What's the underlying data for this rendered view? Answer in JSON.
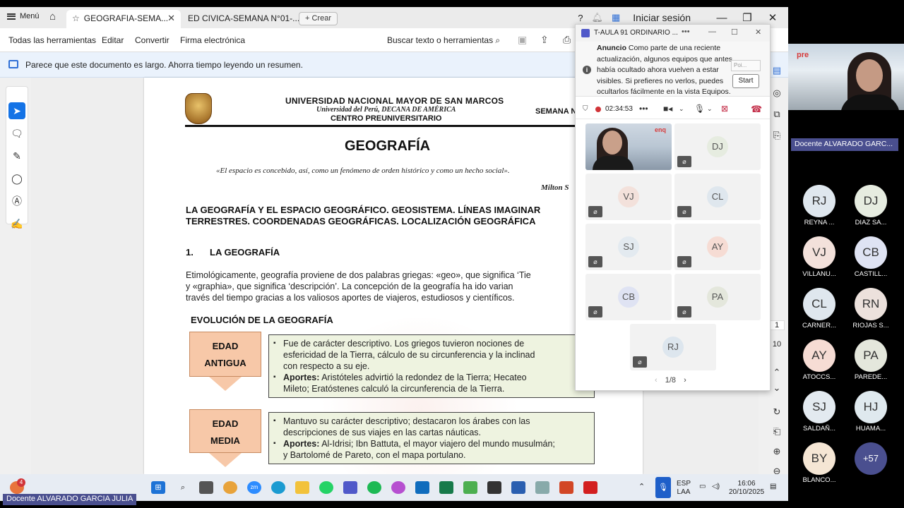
{
  "acrobat": {
    "menu_label": "Menú",
    "tabs": [
      {
        "label": "GEOGRAFIA-SEMA..."
      },
      {
        "label": "ED CIVICA-SEMANA N°01-..."
      }
    ],
    "create_label": "Crear",
    "login_label": "Iniciar sesión",
    "toolbar": {
      "all_tools": "Todas las herramientas",
      "edit": "Editar",
      "convert": "Convertir",
      "esign": "Firma electrónica",
      "search": "Buscar texto o herramientas"
    },
    "notice": "Parece que este documento es largo. Ahorra tiempo leyendo un resumen.",
    "page_numbers": [
      "1",
      "10"
    ]
  },
  "document": {
    "university": "UNIVERSIDAD NACIONAL MAYOR DE SAN MARCOS",
    "subtitle": "Universidad del Perú, DECANA DE AMÉRICA",
    "center": "CENTRO PREUNIVERSITARIO",
    "semana": "SEMANA N",
    "title": "GEOGRAFÍA",
    "quote": "«El espacio es concebido, así, como un fenómeno de orden histórico y como un hecho social».",
    "quote_author": "Milton S",
    "section_heading_line1": "LA GEOGRAFÍA Y EL ESPACIO GEOGRÁFICO. GEOSISTEMA. LÍNEAS IMAGINAR",
    "section_heading_line2": "TERRESTRES. COORDENADAS GEOGRÁFICAS. LOCALIZACIÓN GEOGRÁFICA",
    "sub_number": "1.",
    "sub_title": "LA GEOGRAFÍA",
    "para_line1": "Etimológicamente, geografía proviene de dos palabras griegas: «geo», que significa ‘Tie",
    "para_line2": "y «graphia», que significa ‘descripción’. La concepción de la geografía ha ido varian",
    "para_line3": "través del tiempo gracias a los valiosos aportes de viajeros, estudiosos y científicos.",
    "evolution_heading": "EVOLUCIÓN DE LA GEOGRAFÍA",
    "eras": [
      {
        "label_line1": "EDAD",
        "label_line2": "ANTIGUA",
        "bullet1_line1": "Fue de carácter descriptivo. Los griegos tuvieron nociones de",
        "bullet1_line2": "esfericidad de la Tierra, cálculo de su circunferencia y la inclinad",
        "bullet1_line3": "con respecto a su eje.",
        "bullet2_bold": "Aportes:",
        "bullet2_line1": " Aristóteles advirtió la redondez de la Tierra; Hecateo",
        "bullet2_line2": "Mileto; Eratóstenes calculó la circunferencia de la Tierra."
      },
      {
        "label_line1": "EDAD",
        "label_line2": "MEDIA",
        "bullet1_line1": "Mantuvo su carácter descriptivo; destacaron los árabes con las",
        "bullet1_line2": "descripciones de sus viajes en las cartas náuticas.",
        "bullet2_bold": "Aportes:",
        "bullet2_line1": " Al-Idrisi; Ibn Battuta, el mayor viajero del mundo musulmán;",
        "bullet2_line2": "y Bartolomé de Pareto, con el mapa portulano."
      }
    ]
  },
  "teams": {
    "window_title": "T-AULA 91 ORDINARIO ...",
    "announcement_bold": "Anuncio",
    "announcement_text": " Como parte de una reciente actualización, algunos equipos que antes había ocultado ahora vuelven a estar visibles. Si prefieres no verlos, puedes ocultarlos fácilmente en la vista Equipos.",
    "poi_placeholder": "Poi...",
    "start_label": "Start",
    "timer": "02:34:53",
    "video_badge": "enq",
    "tiles": [
      "DJ",
      "VJ",
      "CL",
      "SJ",
      "AY",
      "CB",
      "PA",
      "RJ"
    ],
    "pager": "1/8"
  },
  "side_panel": {
    "teacher_label": "Docente ALVARADO GARC...",
    "logo_text": "pre",
    "participants": [
      {
        "initials": "RJ",
        "name": "REYNA ..."
      },
      {
        "initials": "DJ",
        "name": "DIAZ SA..."
      },
      {
        "initials": "VJ",
        "name": "VILLANU..."
      },
      {
        "initials": "CB",
        "name": "CASTILL..."
      },
      {
        "initials": "CL",
        "name": "CARNER..."
      },
      {
        "initials": "RN",
        "name": "RIOJAS S..."
      },
      {
        "initials": "AY",
        "name": "ATOCCS..."
      },
      {
        "initials": "PA",
        "name": "PAREDE..."
      },
      {
        "initials": "SJ",
        "name": "SALDAÑ..."
      },
      {
        "initials": "HJ",
        "name": "HUAMA..."
      },
      {
        "initials": "BY",
        "name": "BLANCO..."
      },
      {
        "initials": "+57",
        "name": ""
      }
    ]
  },
  "taskbar": {
    "notification_count": "4",
    "lang_line1": "ESP",
    "lang_line2": "LAA",
    "time": "16:06",
    "date": "20/10/2025"
  },
  "bottom_label": "Docente ALVARADO GARCIA JULIA",
  "colors": {
    "acrobat_blue": "#1473e6",
    "teams_purple": "#4a4f8f",
    "era_orange": "#f7c8a8",
    "era_green": "#eef3e0",
    "record_red": "#d13438"
  }
}
